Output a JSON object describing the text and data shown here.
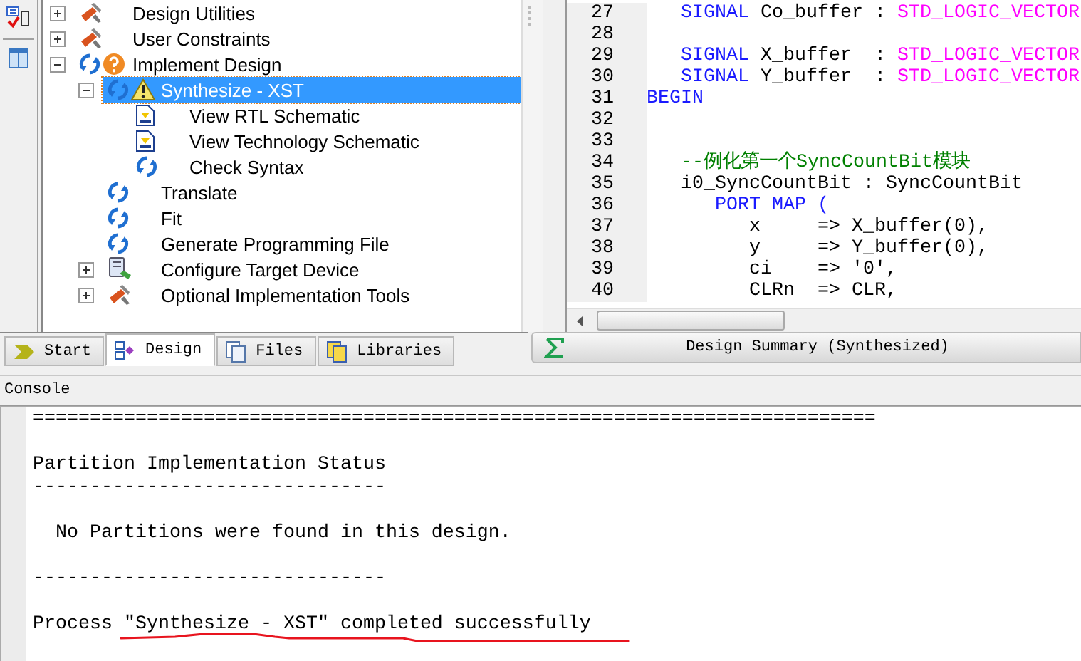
{
  "process_tree": [
    {
      "label": "Design Utilities",
      "kind": "tools",
      "expanded": false,
      "selected": false
    },
    {
      "label": "User Constraints",
      "kind": "tools",
      "expanded": false,
      "selected": false
    },
    {
      "label": "Implement Design",
      "kind": "pending",
      "expanded": true,
      "selected": false,
      "children": [
        {
          "label": "Synthesize - XST",
          "kind": "warned",
          "expanded": true,
          "selected": true,
          "children": [
            {
              "label": "View RTL Schematic",
              "kind": "schematic",
              "selected": false
            },
            {
              "label": "View Technology Schematic",
              "kind": "schematic",
              "selected": false
            },
            {
              "label": "Check Syntax",
              "kind": "process",
              "selected": false
            }
          ]
        },
        {
          "label": "Translate",
          "kind": "process",
          "selected": false
        },
        {
          "label": "Fit",
          "kind": "process",
          "selected": false
        },
        {
          "label": "Generate Programming File",
          "kind": "process",
          "selected": false
        },
        {
          "label": "Configure Target Device",
          "kind": "device",
          "expanded": false,
          "selected": false
        },
        {
          "label": "Optional Implementation Tools",
          "kind": "tools",
          "expanded": false,
          "selected": false
        }
      ]
    }
  ],
  "editor": {
    "lines": [
      {
        "number": "27",
        "tokens": [
          {
            "kind": "keyword",
            "text": "   SIGNAL"
          },
          {
            "kind": "plain",
            "text": " Co_buffer : "
          },
          {
            "kind": "type",
            "text": "STD_LOGIC_VECTOR"
          }
        ]
      },
      {
        "number": "28"
      },
      {
        "number": "29",
        "tokens": [
          {
            "kind": "keyword",
            "text": "   SIGNAL"
          },
          {
            "kind": "plain",
            "text": " X_buffer  : "
          },
          {
            "kind": "type",
            "text": "STD_LOGIC_VECTOR"
          }
        ]
      },
      {
        "number": "30",
        "tokens": [
          {
            "kind": "keyword",
            "text": "   SIGNAL"
          },
          {
            "kind": "plain",
            "text": " Y_buffer  : "
          },
          {
            "kind": "type",
            "text": "STD_LOGIC_VECTOR"
          }
        ]
      },
      {
        "number": "31",
        "tokens": [
          {
            "kind": "keyword",
            "text": "BEGIN"
          }
        ]
      },
      {
        "number": "32"
      },
      {
        "number": "33"
      },
      {
        "number": "34",
        "tokens": [
          {
            "kind": "comment",
            "text": "   --例化第一个SyncCountBit模块"
          }
        ]
      },
      {
        "number": "35",
        "tokens": [
          {
            "kind": "plain",
            "text": "   i0_SyncCountBit : SyncCountBit"
          }
        ]
      },
      {
        "number": "36",
        "tokens": [
          {
            "kind": "keyword",
            "text": "      PORT MAP ("
          }
        ]
      },
      {
        "number": "37",
        "tokens": [
          {
            "kind": "plain",
            "text": "         x     => X_buffer(0),"
          }
        ]
      },
      {
        "number": "38",
        "tokens": [
          {
            "kind": "plain",
            "text": "         y     => Y_buffer(0),"
          }
        ]
      },
      {
        "number": "39",
        "tokens": [
          {
            "kind": "plain",
            "text": "         ci    => '0',"
          }
        ]
      },
      {
        "number": "40",
        "tokens": [
          {
            "kind": "plain",
            "text": "         CLRn  => CLR,"
          }
        ]
      }
    ]
  },
  "left_tabs": [
    {
      "label": "Start",
      "kind": "start",
      "selected": false
    },
    {
      "label": "Design",
      "kind": "design",
      "selected": true
    },
    {
      "label": "Files",
      "kind": "files",
      "selected": false
    },
    {
      "label": "Libraries",
      "kind": "libraries",
      "selected": false
    }
  ],
  "right_tabs": [
    {
      "label": "Design Summary (Synthesized)",
      "kind": "summary"
    }
  ],
  "console": {
    "title": "Console",
    "blocks": [
      [
        "=========================================================================="
      ],
      [
        "Partition Implementation Status",
        "-------------------------------"
      ],
      [
        "  No Partitions were found in this design."
      ],
      [
        "-------------------------------"
      ],
      [
        "Process \"Synthesize - XST\" completed successfully"
      ]
    ]
  }
}
